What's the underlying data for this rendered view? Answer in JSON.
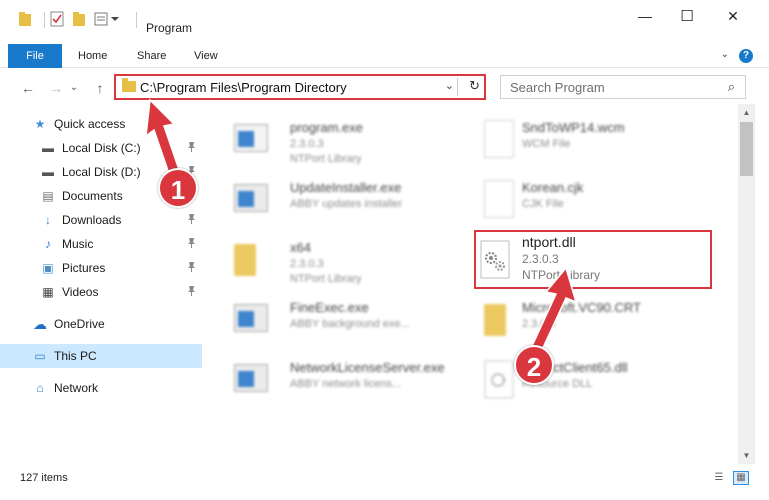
{
  "window": {
    "title": "Program",
    "minimize": "—",
    "maximize": "☐",
    "close": "✕"
  },
  "ribbon": {
    "tabs": [
      "File",
      "Home",
      "Share",
      "View"
    ],
    "expand": "⌄",
    "help": "?"
  },
  "nav": {
    "back": "←",
    "forward": "→",
    "recent": "⌄",
    "up": "↑",
    "address": "C:\\Program Files\\Program Directory",
    "address_dropdown": "⌄",
    "refresh": "↻",
    "search_placeholder": "Search Program",
    "search_icon": "⌕"
  },
  "sidebar": {
    "items": [
      {
        "label": "Quick access",
        "icon": "★",
        "icon_color": "#3d8fd8",
        "pinned": false
      },
      {
        "label": "Local Disk (C:)",
        "icon": "▬",
        "icon_color": "#555555",
        "pinned": true
      },
      {
        "label": "Local Disk (D:)",
        "icon": "▬",
        "icon_color": "#555555",
        "pinned": true
      },
      {
        "label": "Documents",
        "icon": "▤",
        "icon_color": "#6f6f6f",
        "pinned": true
      },
      {
        "label": "Downloads",
        "icon": "↓",
        "icon_color": "#2f7fd1",
        "pinned": true
      },
      {
        "label": "Music",
        "icon": "♪",
        "icon_color": "#2f7fd1",
        "pinned": true
      },
      {
        "label": "Pictures",
        "icon": "▣",
        "icon_color": "#4d8ec9",
        "pinned": true
      },
      {
        "label": "Videos",
        "icon": "▦",
        "icon_color": "#444444",
        "pinned": true
      },
      {
        "label": "OneDrive",
        "icon": "☁",
        "icon_color": "#1e6fc6",
        "pinned": false
      },
      {
        "label": "This PC",
        "icon": "▭",
        "icon_color": "#2f7fd1",
        "pinned": false,
        "selected": true
      },
      {
        "label": "Network",
        "icon": "⌂",
        "icon_color": "#2f7fd1",
        "pinned": false
      }
    ],
    "pin_icon": "📌"
  },
  "files": [
    {
      "name": "program.exe",
      "line1": "2.3.0.3",
      "line2": "NTPort Library",
      "kind": "exe"
    },
    {
      "name": "SndToWP14.wcm",
      "line1": "WCM File",
      "line2": "",
      "kind": "doc"
    },
    {
      "name": "UpdateInstaller.exe",
      "line1": "ABBY updates installer",
      "line2": "",
      "kind": "exe"
    },
    {
      "name": "Korean.cjk",
      "line1": "CJK File",
      "line2": "",
      "kind": "doc"
    },
    {
      "name": "x64",
      "line1": "2.3.0.3",
      "line2": "NTPort Library",
      "kind": "folder"
    },
    {
      "name": "ntport.dll",
      "line1": "2.3.0.3",
      "line2": "NTPort Library",
      "kind": "dll"
    },
    {
      "name": "FineExec.exe",
      "line1": "ABBY background exe...",
      "line2": "",
      "kind": "exe"
    },
    {
      "name": "Microsoft.VC90.CRT",
      "line1": "2.3.0.3",
      "line2": "",
      "kind": "folder"
    },
    {
      "name": "NetworkLicenseServer.exe",
      "line1": "ABBY network licens...",
      "line2": "",
      "kind": "exe"
    },
    {
      "name": "ProtectClient65.dll",
      "line1": "Resource DLL",
      "line2": "",
      "kind": "dll"
    }
  ],
  "scrollbar": {
    "up": "▲",
    "down": "▼"
  },
  "status": {
    "items": "127 items",
    "details_view": "☰",
    "tiles_view": "▦"
  },
  "callouts": {
    "one": "1",
    "two": "2"
  },
  "colors": {
    "accent": "#1979ca",
    "highlight": "#d9363e",
    "selected": "#cce8ff"
  }
}
